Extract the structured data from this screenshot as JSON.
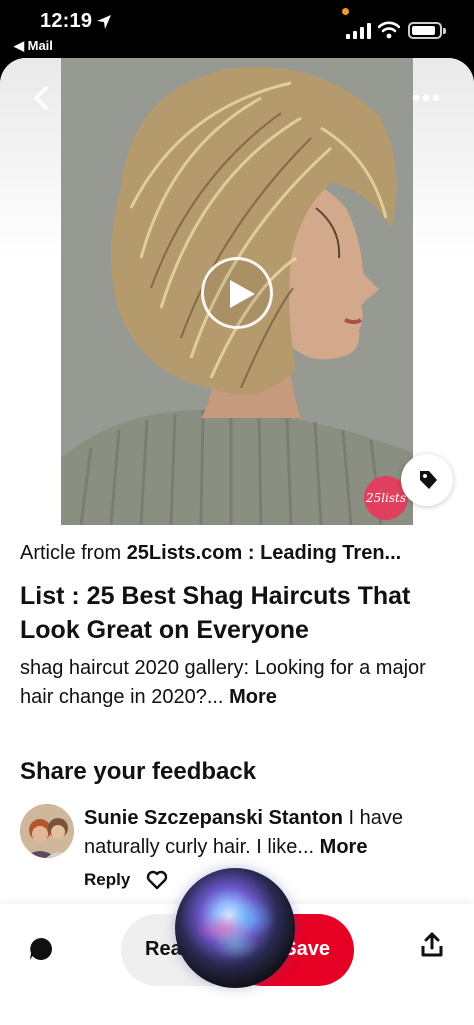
{
  "status_bar": {
    "time": "12:19",
    "back_app_label": "◀ Mail",
    "location_icon": "location-arrow-icon",
    "signal_icon": "cellular-signal-icon",
    "wifi_icon": "wifi-icon",
    "battery_icon": "battery-icon"
  },
  "media": {
    "back_icon": "chevron-left-icon",
    "more_icon": "ellipsis-icon",
    "play_icon": "play-icon",
    "tag_icon": "tag-icon",
    "watermark": "25lists"
  },
  "pin": {
    "source_prefix": "Article from ",
    "source_name": "25Lists.com : Leading Tren...",
    "title": "List : 25 Best Shag Haircuts That Look Great on Everyone",
    "description": "shag haircut 2020 gallery: Looking for a major hair change in 2020?...",
    "more_label": "More"
  },
  "feedback": {
    "heading": "Share your feedback",
    "comment": {
      "author": "Sunie Szczepanski Stanton",
      "text": " I have naturally curly hair. I like...",
      "more_label": "More",
      "reply_label": "Reply"
    }
  },
  "bottom_bar": {
    "read_label": "Read",
    "save_label": "Save",
    "comment_icon": "comment-bubble-icon",
    "share_icon": "share-icon",
    "save_color": "#e60023"
  }
}
